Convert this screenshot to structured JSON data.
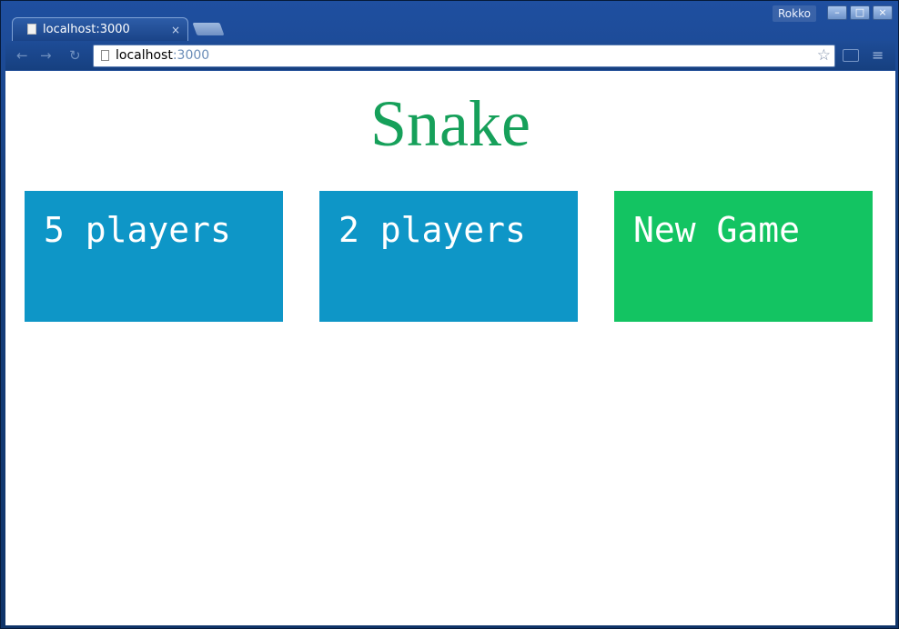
{
  "window": {
    "user_label": "Rokko",
    "min_glyph": "–",
    "max_glyph": "□",
    "close_glyph": "×"
  },
  "tab": {
    "title": "localhost:3000",
    "close_glyph": "×"
  },
  "toolbar": {
    "url_host": "localhost",
    "url_port": ":3000",
    "back_glyph": "←",
    "forward_glyph": "→",
    "reload_glyph": "↻",
    "star_glyph": "☆",
    "menu_glyph": "≡"
  },
  "page": {
    "title": "Snake",
    "buttons": [
      {
        "label": "5 players",
        "color": "#0e96c7"
      },
      {
        "label": "2 players",
        "color": "#0e96c7"
      },
      {
        "label": "New Game",
        "color": "#13c462"
      }
    ],
    "title_color": "#16a05a"
  }
}
